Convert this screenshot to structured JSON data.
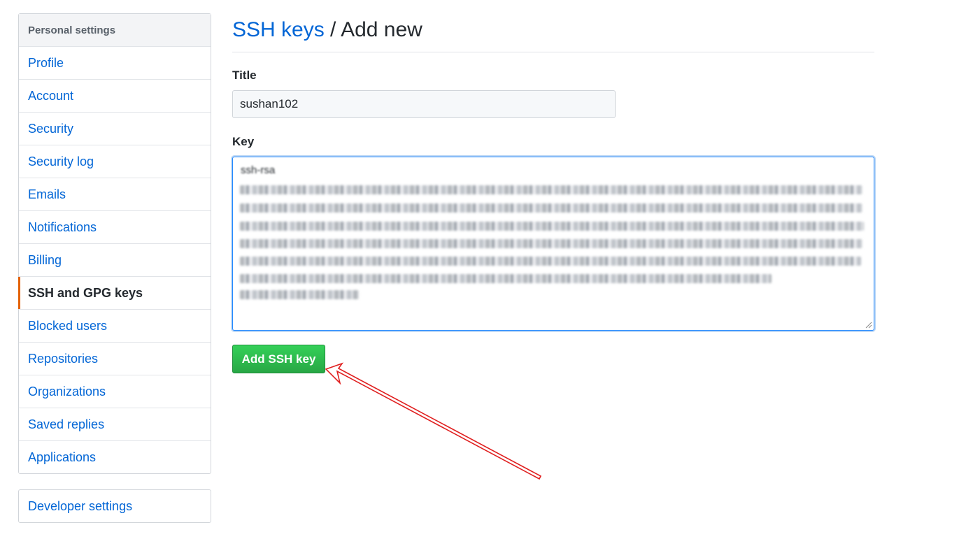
{
  "sidebar": {
    "heading": "Personal settings",
    "items": [
      {
        "label": "Profile",
        "selected": false
      },
      {
        "label": "Account",
        "selected": false
      },
      {
        "label": "Security",
        "selected": false
      },
      {
        "label": "Security log",
        "selected": false
      },
      {
        "label": "Emails",
        "selected": false
      },
      {
        "label": "Notifications",
        "selected": false
      },
      {
        "label": "Billing",
        "selected": false
      },
      {
        "label": "SSH and GPG keys",
        "selected": true
      },
      {
        "label": "Blocked users",
        "selected": false
      },
      {
        "label": "Repositories",
        "selected": false
      },
      {
        "label": "Organizations",
        "selected": false
      },
      {
        "label": "Saved replies",
        "selected": false
      },
      {
        "label": "Applications",
        "selected": false
      }
    ],
    "developer_settings": "Developer settings"
  },
  "header": {
    "breadcrumb_link": "SSH keys",
    "separator": " / ",
    "current": "Add new"
  },
  "form": {
    "title_label": "Title",
    "title_value": "sushan102",
    "key_label": "Key",
    "key_first_line": "ssh-rsa",
    "submit_label": "Add SSH key"
  },
  "colors": {
    "accent": "#0366d6",
    "selected_marker": "#e36209",
    "button_green": "#28a745",
    "annotation_arrow": "#e02020"
  },
  "annotation": {
    "type": "arrow",
    "points_to": "submit-button"
  }
}
